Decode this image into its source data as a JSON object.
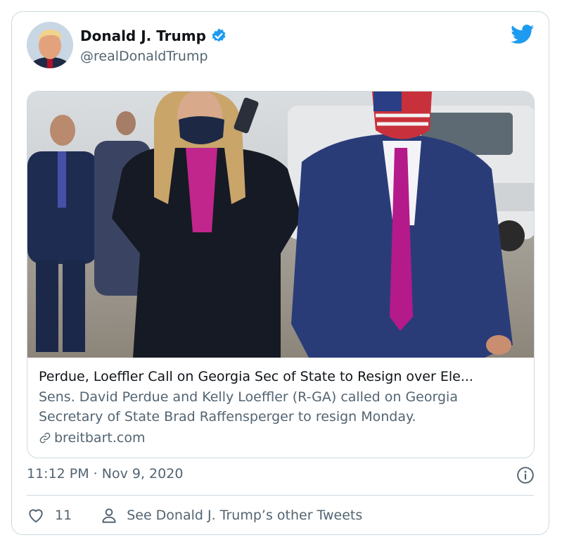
{
  "author": {
    "name": "Donald J. Trump",
    "handle": "@realDonaldTrump"
  },
  "card": {
    "title": "Perdue, Loeffler Call on Georgia Sec of State to Resign over Ele...",
    "description": "Sens. David Perdue and Kelly Loeffler (R-GA) called on Georgia Secretary of State Brad Raffensperger to resign Monday.",
    "domain": "breitbart.com"
  },
  "timestamp": "11:12 PM · Nov 9, 2020",
  "actions": {
    "like_count": "11",
    "other_tweets_label": "See Donald J. Trump’s other Tweets"
  },
  "icons": {
    "verified": "verified-badge-icon",
    "brand": "twitter-bird-icon",
    "info": "info-icon",
    "like": "heart-icon",
    "profile": "person-icon",
    "link": "link-icon"
  },
  "colors": {
    "twitter_blue": "#1d9bf0",
    "text_secondary": "#536471",
    "border": "#cfd9de"
  }
}
